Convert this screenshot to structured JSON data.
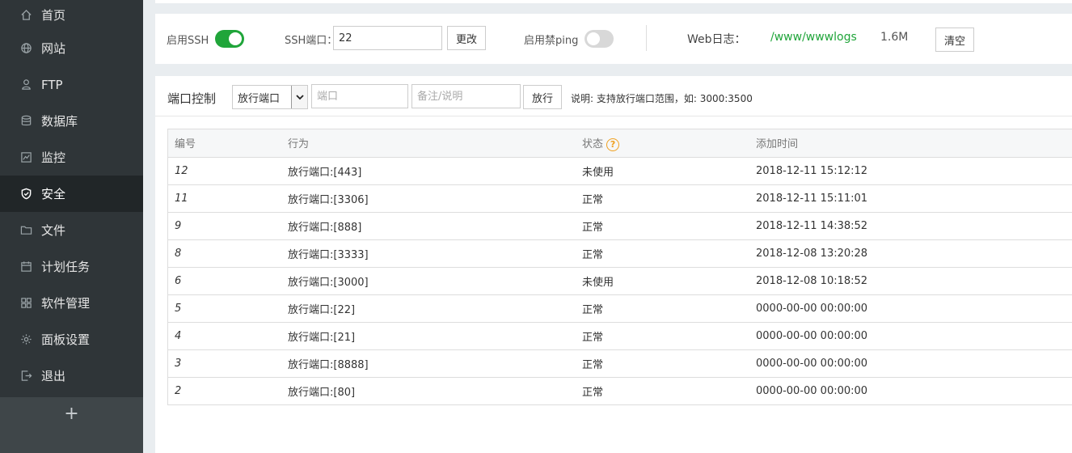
{
  "sidebar": {
    "items": [
      {
        "label": "首页",
        "icon": "home-icon"
      },
      {
        "label": "网站",
        "icon": "globe-icon"
      },
      {
        "label": "FTP",
        "icon": "ftp-icon"
      },
      {
        "label": "数据库",
        "icon": "database-icon"
      },
      {
        "label": "监控",
        "icon": "monitor-icon"
      },
      {
        "label": "安全",
        "icon": "shield-icon",
        "active": true
      },
      {
        "label": "文件",
        "icon": "folder-icon"
      },
      {
        "label": "计划任务",
        "icon": "calendar-icon"
      },
      {
        "label": "软件管理",
        "icon": "grid-icon"
      },
      {
        "label": "面板设置",
        "icon": "gear-icon"
      },
      {
        "label": "退出",
        "icon": "logout-icon"
      }
    ],
    "add_label": "+"
  },
  "ssh": {
    "enable_label": "启用SSH",
    "enabled": true,
    "port_label": "SSH端口：",
    "port_value": "22",
    "change_button": "更改",
    "ping_label": "启用禁ping",
    "ping_enabled": false,
    "weblog_label": "Web日志：",
    "weblog_path": "/www/wwwlogs",
    "weblog_size": "1.6M",
    "clear_button": "清空"
  },
  "port_control": {
    "title": "端口控制",
    "select_value": "放行端口",
    "port_placeholder": "端口",
    "note_placeholder": "备注/说明",
    "allow_button": "放行",
    "hint": "说明: 支持放行端口范围，如: 3000:3500"
  },
  "table": {
    "headers": [
      "编号",
      "行为",
      "状态",
      "添加时间"
    ],
    "rows": [
      {
        "id": "12",
        "action": "放行端口:[443]",
        "status": "未使用",
        "time": "2018-12-11 15:12:12"
      },
      {
        "id": "11",
        "action": "放行端口:[3306]",
        "status": "正常",
        "time": "2018-12-11 15:11:01"
      },
      {
        "id": "9",
        "action": "放行端口:[888]",
        "status": "正常",
        "time": "2018-12-11 14:38:52"
      },
      {
        "id": "8",
        "action": "放行端口:[3333]",
        "status": "正常",
        "time": "2018-12-08 13:20:28"
      },
      {
        "id": "6",
        "action": "放行端口:[3000]",
        "status": "未使用",
        "time": "2018-12-08 10:18:52"
      },
      {
        "id": "5",
        "action": "放行端口:[22]",
        "status": "正常",
        "time": "0000-00-00 00:00:00"
      },
      {
        "id": "4",
        "action": "放行端口:[21]",
        "status": "正常",
        "time": "0000-00-00 00:00:00"
      },
      {
        "id": "3",
        "action": "放行端口:[8888]",
        "status": "正常",
        "time": "0000-00-00 00:00:00"
      },
      {
        "id": "2",
        "action": "放行端口:[80]",
        "status": "正常",
        "time": "0000-00-00 00:00:00"
      }
    ]
  },
  "colors": {
    "accent_green": "#20a53a",
    "sidebar_bg": "#2f3538",
    "sidebar_active": "#212628",
    "help_orange": "#f0a020"
  }
}
